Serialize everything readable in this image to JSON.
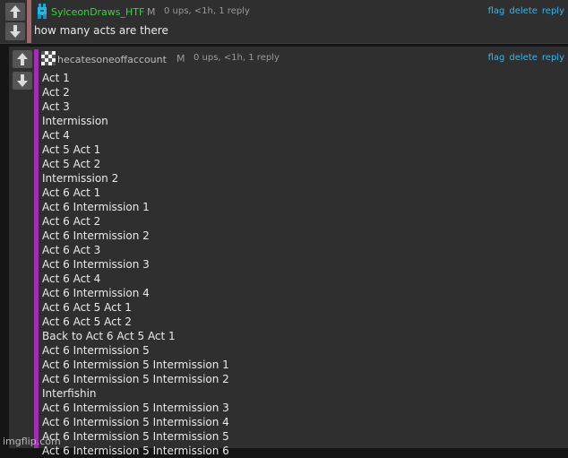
{
  "comments": [
    {
      "username": "SylceonDraws_HTF",
      "mod_badge": "M",
      "meta": "0 ups, <1h, 1 reply",
      "text": "how many acts are there",
      "actions": [
        "flag",
        "delete",
        "reply"
      ],
      "username_color": "#3fd23f",
      "bar_color": "#9a6a6e"
    },
    {
      "username": "hecatesoneoffaccount",
      "mod_badge": "M",
      "meta": "0 ups, <1h, 1 reply",
      "actions": [
        "flag",
        "delete",
        "reply"
      ],
      "bar_color": "#a12fb2",
      "lines": [
        "Act 1",
        "Act 2",
        "Act 3",
        "Intermission",
        "Act 4",
        "Act 5 Act 1",
        "Act 5 Act 2",
        "Intermission 2",
        "Act 6 Act 1",
        "Act 6 Intermission 1",
        "Act 6 Act 2",
        "Act 6 Intermission 2",
        "Act 6 Act 3",
        "Act 6 Intermission 3",
        "Act 6 Act 4",
        "Act 6 Intermission 4",
        "Act 6 Act 5 Act 1",
        "Act 6 Act 5 Act 2",
        "Back to Act 6 Act 5 Act 1",
        "Act 6 Intermission 5",
        "Act 6 Intermission 5 Intermission 1",
        "Act 6 Intermission 5 Intermission 2",
        "Interfishin",
        "Act 6 Intermission 5 Intermission 3",
        "Act 6 Intermission 5 Intermission 4",
        "Act 6 Intermission 5 Intermission 5",
        "Act 6 Intermission 5 Intermission 6"
      ]
    }
  ],
  "icons": [
    "upvote-arrow-icon",
    "downvote-arrow-icon",
    "user-avatar-icon"
  ],
  "watermark": "imgflip.com"
}
